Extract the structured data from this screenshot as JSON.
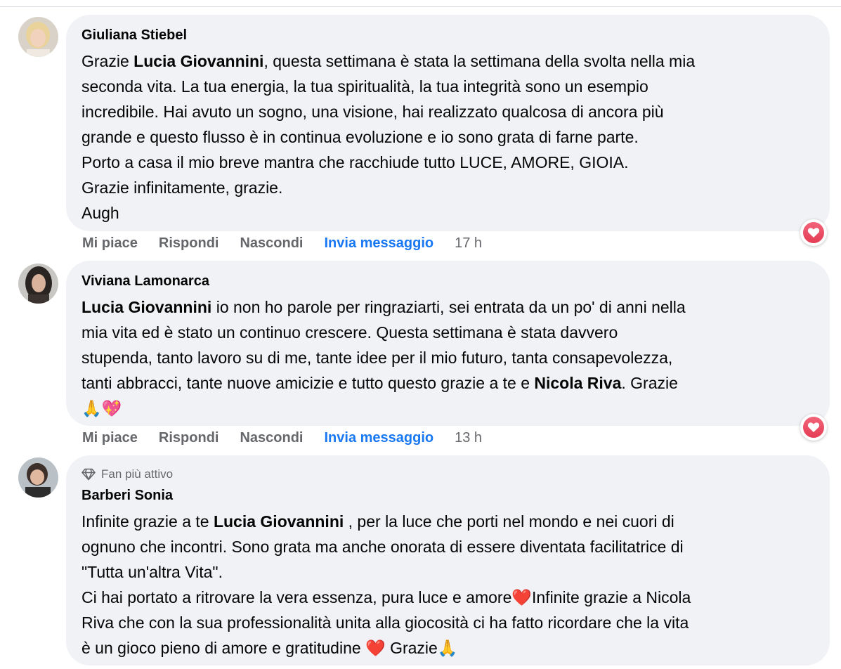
{
  "comments": [
    {
      "author": "Giuliana Stiebel",
      "lines": [
        [
          {
            "t": "Grazie "
          },
          {
            "t": "Lucia Giovannini",
            "b": true
          },
          {
            "t": ", questa settimana è stata la settimana della svolta nella mia"
          }
        ],
        [
          {
            "t": "seconda vita. La tua energia, la tua spiritualità, la tua integrità sono un esempio"
          }
        ],
        [
          {
            "t": "incredibile. Hai avuto un sogno, una visione, hai realizzato qualcosa di ancora più"
          }
        ],
        [
          {
            "t": "grande e questo flusso è in continua evoluzione e io sono grata di farne parte."
          }
        ],
        [
          {
            "t": "Porto a casa il mio breve mantra che racchiude tutto LUCE, AMORE, GIOIA."
          }
        ],
        [
          {
            "t": "Grazie infinitamente, grazie."
          }
        ],
        [
          {
            "t": "Augh"
          }
        ]
      ],
      "actions": {
        "like": "Mi piace",
        "reply": "Rispondi",
        "hide": "Nascondi",
        "message": "Invia messaggio",
        "time": "17 h"
      },
      "reaction_icon": "heart-icon"
    },
    {
      "author": "Viviana Lamonarca",
      "lines": [
        [
          {
            "t": "Lucia Giovannini",
            "b": true
          },
          {
            "t": " io non ho parole per ringraziarti, sei entrata da un po' di anni nella"
          }
        ],
        [
          {
            "t": "mia vita ed è stato un continuo crescere. Questa settimana è stata davvero"
          }
        ],
        [
          {
            "t": "stupenda, tanto lavoro su di me, tante idee per il mio futuro, tanta consapevolezza,"
          }
        ],
        [
          {
            "t": "tanti abbracci, tante nuove amicizie e tutto questo grazie a te e "
          },
          {
            "t": "Nicola Riva",
            "b": true
          },
          {
            "t": ". Grazie"
          }
        ],
        [
          {
            "t": "🙏💖"
          }
        ]
      ],
      "actions": {
        "like": "Mi piace",
        "reply": "Rispondi",
        "hide": "Nascondi",
        "message": "Invia messaggio",
        "time": "13 h"
      },
      "reaction_icon": "heart-icon"
    },
    {
      "badge": "Fan più attivo",
      "author": "Barberi Sonia",
      "lines": [
        [
          {
            "t": "Infinite grazie a te "
          },
          {
            "t": "Lucia Giovannini",
            "b": true
          },
          {
            "t": " , per la luce che porti nel mondo e nei cuori di"
          }
        ],
        [
          {
            "t": "ognuno che incontri. Sono grata ma anche onorata di essere diventata facilitatrice di"
          }
        ],
        [
          {
            "t": "\"Tutta un'altra Vita\"."
          }
        ],
        [
          {
            "t": "Ci hai portato a ritrovare la vera essenza, pura luce e amore❤️Infinite grazie a Nicola"
          }
        ],
        [
          {
            "t": "Riva che con la sua professionalità unita alla giocosità ci ha fatto ricordare che la vita"
          }
        ],
        [
          {
            "t": "è un gioco pieno di amore e gratitudine ❤️ Grazie🙏"
          }
        ]
      ]
    }
  ],
  "colors": {
    "bubble": "#f0f2f5",
    "link": "#1877f2",
    "muted": "#65676b",
    "heart": "#e43d54"
  }
}
